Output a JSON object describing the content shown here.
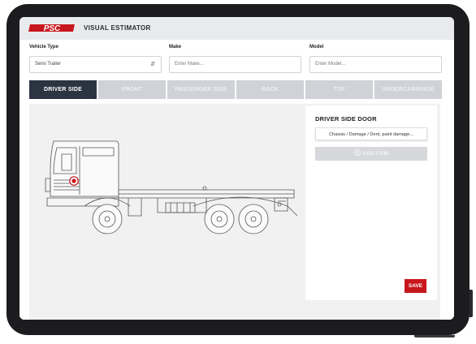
{
  "header": {
    "app_title": "VISUAL ESTIMATOR",
    "logo_text": "PSC",
    "logo_color": "#c8161d"
  },
  "form": {
    "vehicle_type": {
      "label": "Vehicle Type",
      "value": "Semi Trailer"
    },
    "make": {
      "label": "Make",
      "placeholder": "Enter Make..."
    },
    "model": {
      "label": "Model",
      "placeholder": "Enter Model..."
    }
  },
  "tabs": [
    {
      "label": "DRIVER SIDE",
      "active": true
    },
    {
      "label": "FRONT",
      "active": false
    },
    {
      "label": "PASSENGER SIDE",
      "active": false
    },
    {
      "label": "BACK",
      "active": false
    },
    {
      "label": "TOP",
      "active": false
    },
    {
      "label": "UNDERCARRIAGE",
      "active": false
    }
  ],
  "panel": {
    "title": "DRIVER SIDE DOOR",
    "items": [
      "Chassis / Damage / Dent, paint damage..."
    ],
    "add_item_label": "ADD ITEM",
    "add_item_icon": "plus-circle-icon",
    "save_label": "SAVE"
  },
  "colors": {
    "active_tab": "#2b3441",
    "inactive_tab": "#cfd2d6",
    "accent_red": "#c8161d"
  }
}
